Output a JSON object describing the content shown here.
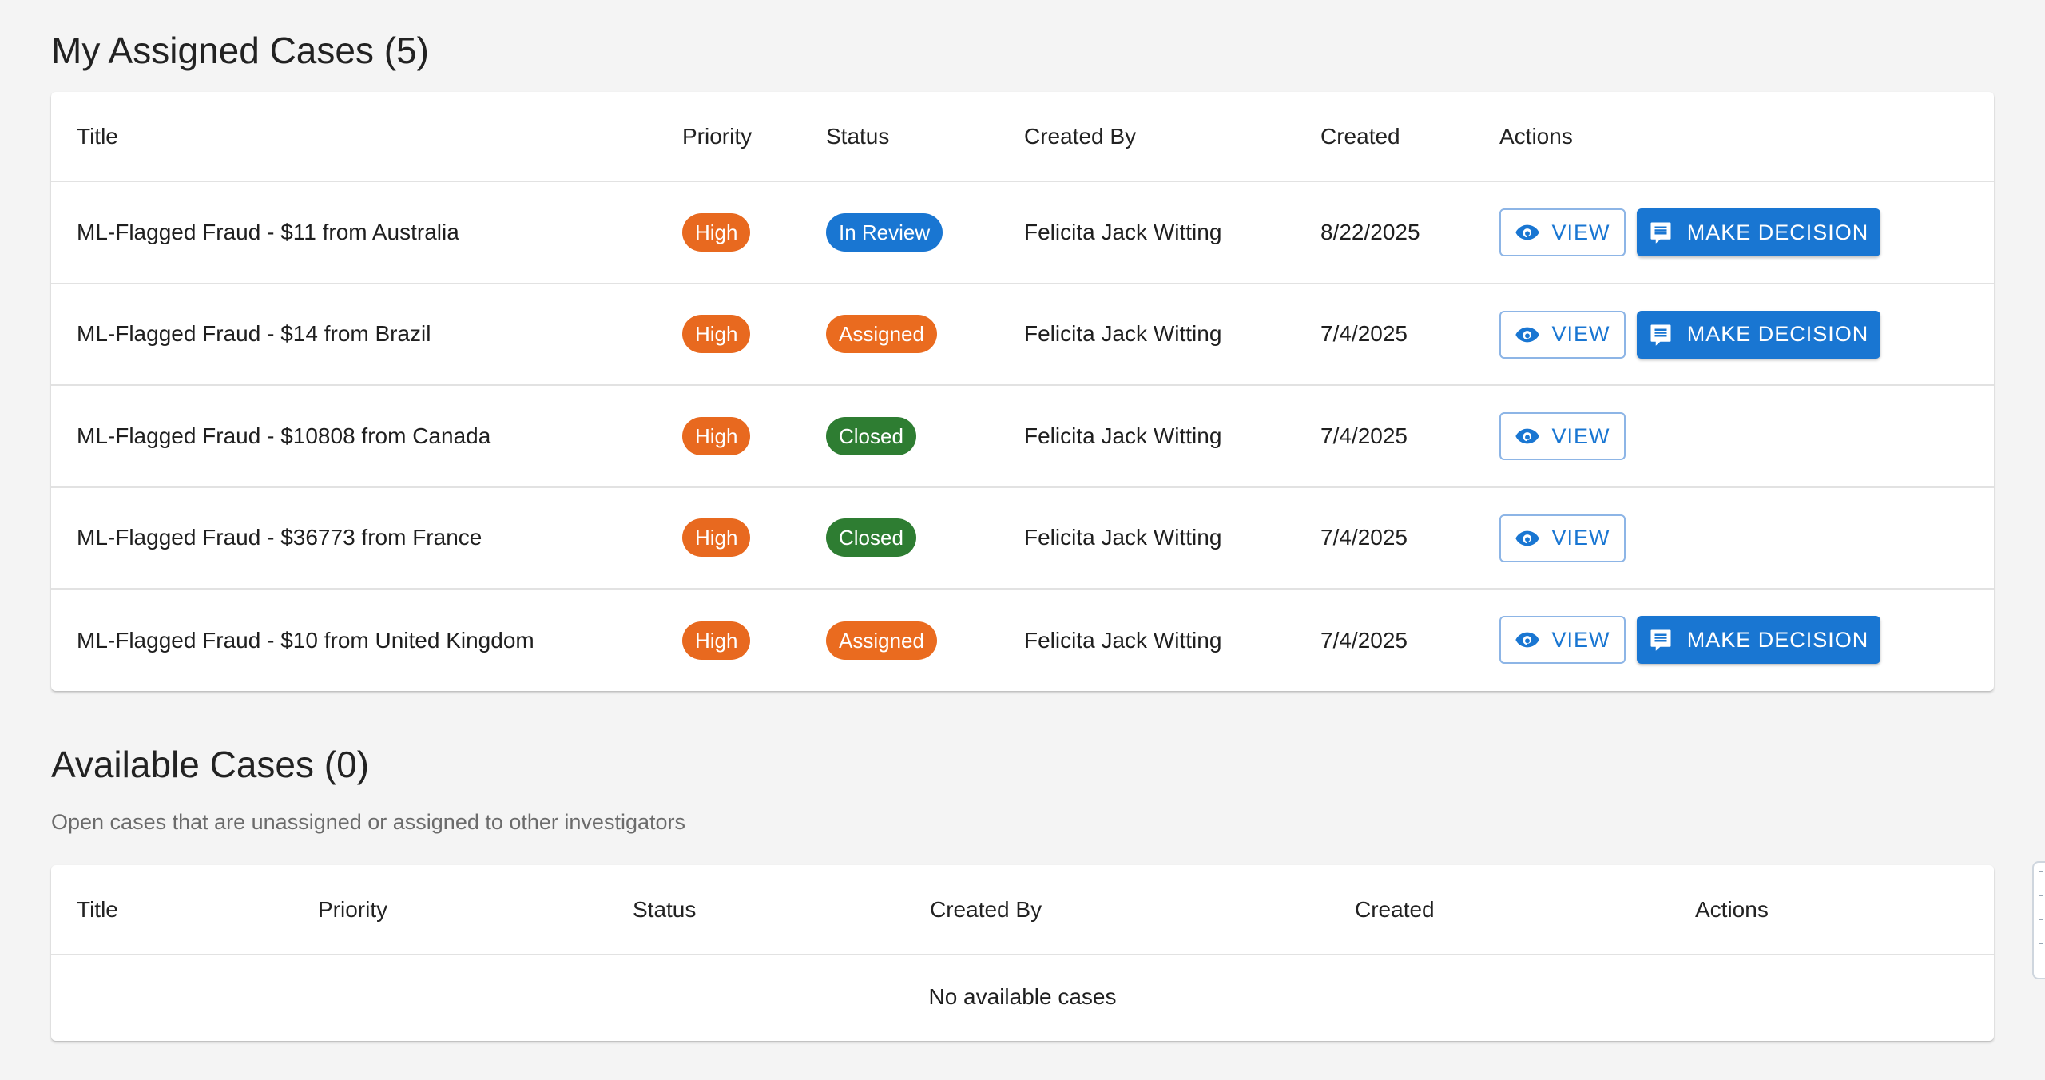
{
  "assigned": {
    "title": "My Assigned Cases (5)",
    "columns": {
      "title": "Title",
      "priority": "Priority",
      "status": "Status",
      "created_by": "Created By",
      "created": "Created",
      "actions": "Actions"
    },
    "rows": [
      {
        "title": "ML-Flagged Fraud - $11 from Australia",
        "priority": "High",
        "status": "In Review",
        "created_by": "Felicita Jack Witting",
        "created": "8/22/2025",
        "view_label": "VIEW",
        "decision_label": "MAKE DECISION"
      },
      {
        "title": "ML-Flagged Fraud - $14 from Brazil",
        "priority": "High",
        "status": "Assigned",
        "created_by": "Felicita Jack Witting",
        "created": "7/4/2025",
        "view_label": "VIEW",
        "decision_label": "MAKE DECISION"
      },
      {
        "title": "ML-Flagged Fraud - $10808 from Canada",
        "priority": "High",
        "status": "Closed",
        "created_by": "Felicita Jack Witting",
        "created": "7/4/2025",
        "view_label": "VIEW"
      },
      {
        "title": "ML-Flagged Fraud - $36773 from France",
        "priority": "High",
        "status": "Closed",
        "created_by": "Felicita Jack Witting",
        "created": "7/4/2025",
        "view_label": "VIEW"
      },
      {
        "title": "ML-Flagged Fraud - $10 from United Kingdom",
        "priority": "High",
        "status": "Assigned",
        "created_by": "Felicita Jack Witting",
        "created": "7/4/2025",
        "view_label": "VIEW",
        "decision_label": "MAKE DECISION"
      }
    ]
  },
  "available": {
    "title": "Available Cases (0)",
    "subtitle": "Open cases that are unassigned or assigned to other investigators",
    "columns": {
      "title": "Title",
      "priority": "Priority",
      "status": "Status",
      "created_by": "Created By",
      "created": "Created",
      "actions": "Actions"
    },
    "empty_message": "No available cases"
  },
  "icons": {
    "view": "eye-icon",
    "decision": "comment-icon"
  },
  "colors": {
    "priority_high": "#e8691f",
    "status_in_review": "#1976d2",
    "status_assigned": "#ea6b1f",
    "status_closed": "#2e7d32",
    "primary": "#1976d2"
  }
}
